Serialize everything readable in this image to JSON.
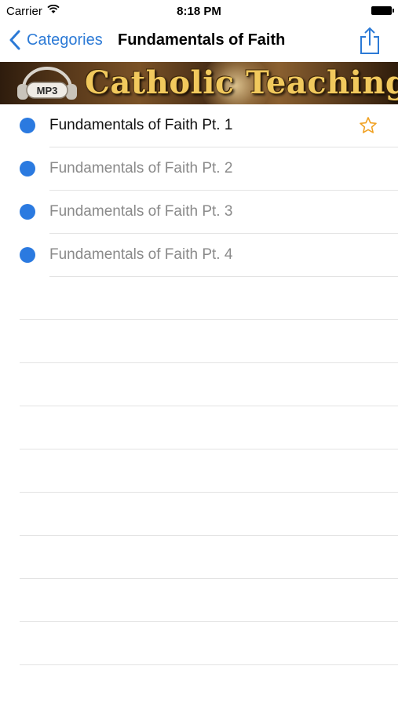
{
  "status_bar": {
    "carrier": "Carrier",
    "time": "8:18 PM"
  },
  "nav": {
    "back_label": "Categories",
    "title": "Fundamentals of Faith"
  },
  "banner": {
    "badge": "MP3",
    "text": "Catholic Teaching"
  },
  "list": {
    "items": [
      {
        "label": "Fundamentals of Faith Pt. 1",
        "active": true,
        "favorite": true
      },
      {
        "label": "Fundamentals of Faith Pt. 2",
        "active": false
      },
      {
        "label": "Fundamentals of Faith Pt. 3",
        "active": false
      },
      {
        "label": "Fundamentals of Faith Pt. 4",
        "active": false
      }
    ]
  },
  "colors": {
    "accent": "#2c7ad6",
    "dot": "#2b7ae0",
    "star": "#f0a020"
  },
  "icons": {
    "back": "chevron-left-icon",
    "share": "share-icon",
    "favorite": "star-outline-icon",
    "wifi": "wifi-icon",
    "battery": "battery-icon",
    "headphones": "headphones-icon"
  }
}
